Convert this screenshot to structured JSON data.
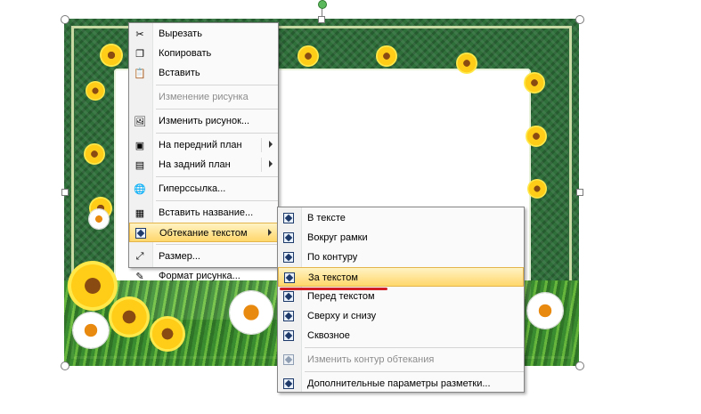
{
  "context_menu": {
    "items": [
      {
        "label": "Вырезать",
        "icon": "scissors-icon",
        "enabled": true
      },
      {
        "label": "Копировать",
        "icon": "copy-icon",
        "enabled": true
      },
      {
        "label": "Вставить",
        "icon": "paste-icon",
        "enabled": true
      },
      {
        "label": "Изменение рисунка",
        "icon": "",
        "enabled": false
      },
      {
        "label": "Изменить рисунок...",
        "icon": "change-picture-icon",
        "enabled": true
      },
      {
        "label": "На передний план",
        "icon": "bring-forward-icon",
        "enabled": true,
        "submenu": true
      },
      {
        "label": "На задний план",
        "icon": "send-backward-icon",
        "enabled": true,
        "submenu": true
      },
      {
        "label": "Гиперссылка...",
        "icon": "hyperlink-icon",
        "enabled": true
      },
      {
        "label": "Вставить название...",
        "icon": "insert-caption-icon",
        "enabled": true
      },
      {
        "label": "Обтекание текстом",
        "icon": "text-wrap-icon",
        "enabled": true,
        "submenu": true,
        "highlighted": true
      },
      {
        "label": "Размер...",
        "icon": "size-icon",
        "enabled": true
      },
      {
        "label": "Формат рисунка...",
        "icon": "format-picture-icon",
        "enabled": true
      }
    ]
  },
  "wrap_submenu": {
    "items": [
      {
        "label": "В тексте",
        "enabled": true
      },
      {
        "label": "Вокруг рамки",
        "enabled": true
      },
      {
        "label": "По контуру",
        "enabled": true
      },
      {
        "label": "За текстом",
        "enabled": true,
        "highlighted": true
      },
      {
        "label": "Перед текстом",
        "enabled": true
      },
      {
        "label": "Сверху и снизу",
        "enabled": true
      },
      {
        "label": "Сквозное",
        "enabled": true
      },
      {
        "label": "Изменить контур обтекания",
        "enabled": false
      },
      {
        "label": "Дополнительные параметры разметки...",
        "enabled": true
      }
    ]
  },
  "colors": {
    "highlight": "#ffd76b",
    "annotation_underline": "#d21f26",
    "frame_green": "#2e6f3a"
  }
}
